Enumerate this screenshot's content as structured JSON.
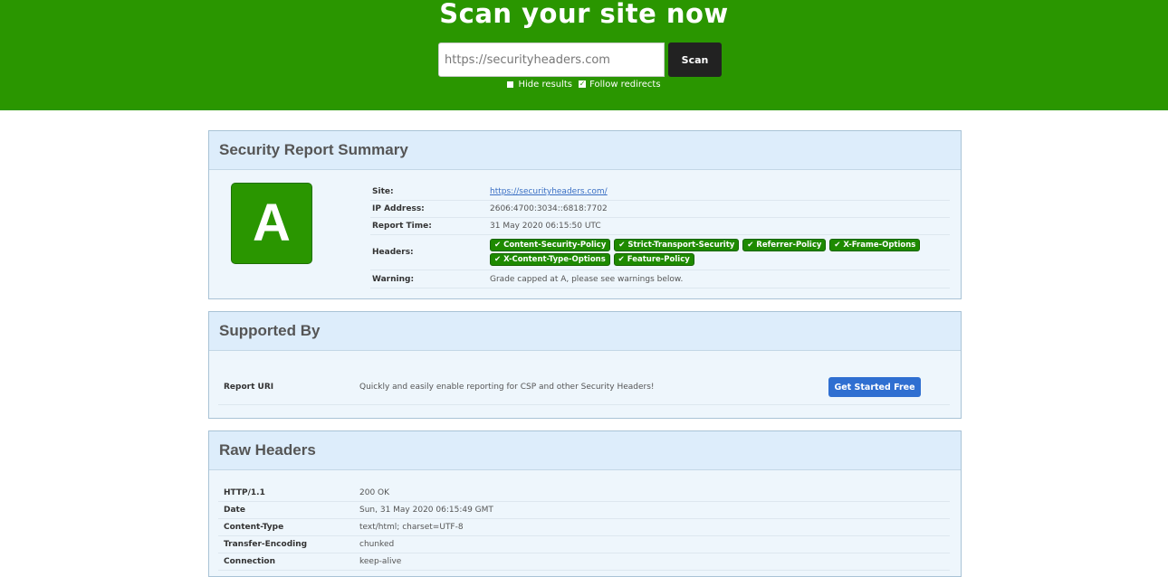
{
  "hero": {
    "title": "Scan your site now",
    "input_value": "",
    "input_placeholder": "https://securityheaders.com",
    "scan_label": "Scan",
    "hide_results_label": "Hide results",
    "follow_redirects_label": "Follow redirects",
    "hide_results_checked": false,
    "follow_redirects_checked": true
  },
  "summary": {
    "title": "Security Report Summary",
    "grade": "A",
    "grade_color": "#2a9600",
    "rows": {
      "site_key": "Site:",
      "site_value": "https://securityheaders.com/",
      "ip_key": "IP Address:",
      "ip_value": "2606:4700:3034::6818:7702",
      "time_key": "Report Time:",
      "time_value": "31 May 2020 06:15:50 UTC",
      "headers_key": "Headers:",
      "warning_key": "Warning:",
      "warning_value": "Grade capped at A, please see warnings below."
    },
    "headers": [
      "Content-Security-Policy",
      "Strict-Transport-Security",
      "Referrer-Policy",
      "X-Frame-Options",
      "X-Content-Type-Options",
      "Feature-Policy"
    ]
  },
  "supported": {
    "title": "Supported By",
    "name": "Report URI",
    "description": "Quickly and easily enable reporting for CSP and other Security Headers!",
    "cta_label": "Get Started Free"
  },
  "raw": {
    "title": "Raw Headers",
    "rows": [
      {
        "k": "HTTP/1.1",
        "v": "200 OK"
      },
      {
        "k": "Date",
        "v": "Sun, 31 May 2020 06:15:49 GMT"
      },
      {
        "k": "Content-Type",
        "v": "text/html; charset=UTF-8"
      },
      {
        "k": "Transfer-Encoding",
        "v": "chunked"
      },
      {
        "k": "Connection",
        "v": "keep-alive"
      }
    ]
  }
}
